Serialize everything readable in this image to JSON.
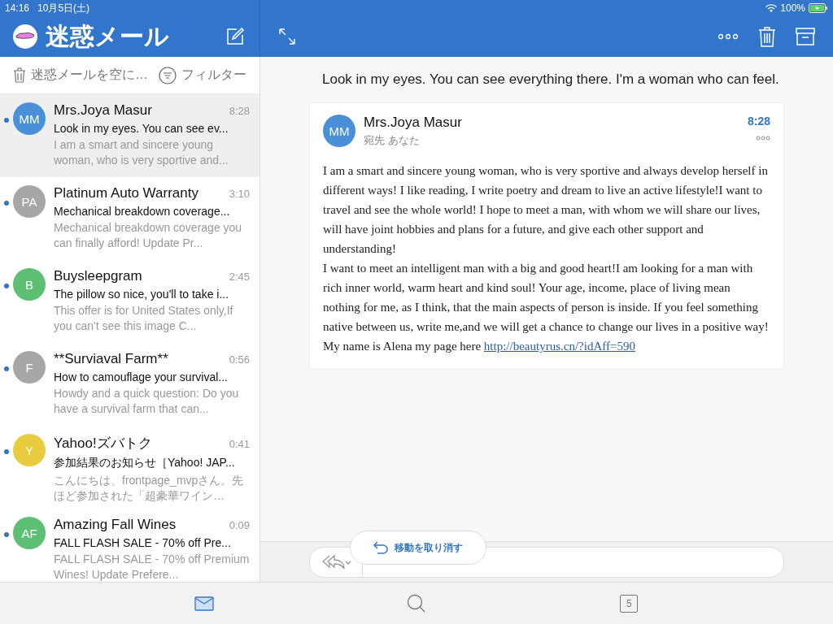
{
  "status_bar": {
    "time": "14:16",
    "date": "10月5日(土)",
    "battery": "100%"
  },
  "sidebar": {
    "title": "迷惑メール",
    "empty_action": "迷惑メールを空に…",
    "filter": "フィルター",
    "messages": [
      {
        "initials": "MM",
        "color": "#4a90d9",
        "sender": "Mrs.Joya Masur",
        "time": "8:28",
        "subject": "Look in my eyes. You can see ev...",
        "preview": "I am a smart and sincere young woman, who is very sportive and...",
        "unread": true,
        "selected": true
      },
      {
        "initials": "PA",
        "color": "#a6a6a6",
        "sender": "Platinum Auto Warranty",
        "time": "3:10",
        "subject": "Mechanical breakdown coverage...",
        "preview": "Mechanical breakdown coverage you can finally afford! Update Pr...",
        "unread": true,
        "selected": false
      },
      {
        "initials": "B",
        "color": "#5cbf73",
        "sender": "Buysleepgram",
        "time": "2:45",
        "subject": "The pillow so nice, you'll to take i...",
        "preview": "This offer is for United States only,If you can't see this image C...",
        "unread": true,
        "selected": false
      },
      {
        "initials": "F",
        "color": "#a6a6a6",
        "sender": "**Surviaval Farm**",
        "time": "0:56",
        "subject": "How to camouflage your survival...",
        "preview": "Howdy and a quick question: Do you have a survival farm that can...",
        "unread": true,
        "selected": false
      },
      {
        "initials": "Y",
        "color": "#e8cc3e",
        "sender": "Yahoo!ズバトク",
        "time": "0:41",
        "subject": "参加結果のお知らせ［Yahoo! JAP...",
        "preview": "こんにちは、frontpage_mvpさん。先ほど参加された「超豪華ワイン…",
        "unread": true,
        "selected": false
      },
      {
        "initials": "AF",
        "color": "#5cbf73",
        "sender": "Amazing Fall Wines",
        "time": "0:09",
        "subject": "FALL FLASH SALE - 70% off Pre...",
        "preview": "FALL FLASH SALE - 70% off Premium Wines! Update Prefere...",
        "unread": true,
        "selected": false
      }
    ]
  },
  "message": {
    "subject": "Look in my eyes. You can see everything there. I'm a woman who can feel.",
    "initials": "MM",
    "sender": "Mrs.Joya Masur",
    "recipients": "宛先 あなた",
    "time": "8:28",
    "body": [
      "I am a smart and sincere young woman, who is very sportive and always develop herself in different ways! I like reading, I write poetry and dream to live an active lifestyle!I want to travel and see the whole world! I hope to meet a man, with whom we will share our lives, will have joint hobbies and plans for a future, and give each other support and understanding!",
      "I want to meet an intelligent man with a big and good heart!I am looking for a man with rich inner world, warm heart and kind soul! Your age, income, place of living mean nothing for me, as I think, that the main aspects of person is inside. If you feel something native between us, write me,and we will get a chance to change our lives in a positive way! My name is Alena my page here "
    ],
    "link": "http://beautyrus.cn/?idAff=590"
  },
  "toast": "移動を取り消す",
  "tab_bar": [
    {
      "kind": "mail",
      "selected": true
    },
    {
      "kind": "search",
      "selected": false
    },
    {
      "kind": "calendar",
      "day": "5",
      "selected": false
    }
  ]
}
